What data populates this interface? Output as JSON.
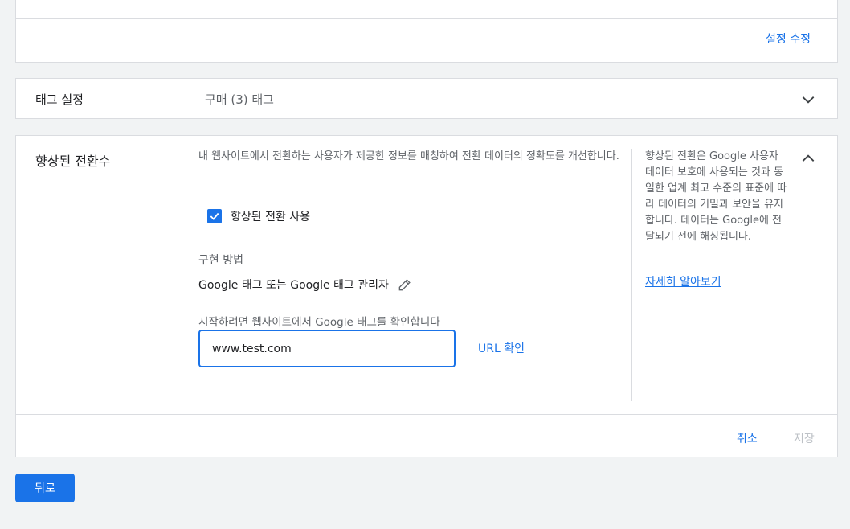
{
  "top_card": {
    "edit_link": "설정 수정"
  },
  "tag_settings": {
    "label": "태그 설정",
    "value": "구매 (3) 태그"
  },
  "enhanced_conversions": {
    "title": "향상된 전환수",
    "description": "내 웹사이트에서 전환하는 사용자가 제공한 정보를 매칭하여 전환 데이터의 정확도를 개선합니다.",
    "checkbox_label": "향상된 전환 사용",
    "checkbox_checked": true,
    "implementation_title": "구현 방법",
    "implementation_value": "Google 태그 또는 Google 태그 관리자",
    "start_label": "시작하려면 웹사이트에서 Google 태그를 확인합니다",
    "url_input_value": "www.test.com",
    "url_check_label": "URL 확인",
    "help_text": "향상된 전환은 Google 사용자 데이터 보호에 사용되는 것과 동일한 업계 최고 수준의 표준에 따라 데이터의 기밀과 보안을 유지합니다. 데이터는 Google에 전달되기 전에 해싱됩니다.",
    "help_link": "자세히 알아보기",
    "cancel_label": "취소",
    "save_label": "저장"
  },
  "back_button": "뒤로",
  "colors": {
    "accent": "#1a73e8",
    "disabled": "#bdc1c6",
    "border": "#dadce0",
    "background": "#f1f3f4"
  }
}
